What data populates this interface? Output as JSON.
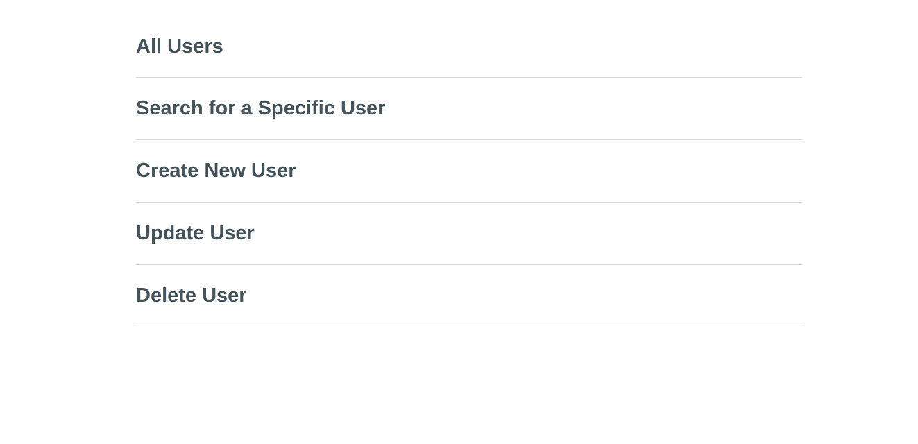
{
  "menu": {
    "items": [
      {
        "label": "All Users"
      },
      {
        "label": "Search for a Specific User"
      },
      {
        "label": "Create New User"
      },
      {
        "label": "Update User"
      },
      {
        "label": "Delete User"
      }
    ]
  },
  "colors": {
    "text": "#44525a",
    "divider": "#d6d6d6",
    "background": "#ffffff"
  }
}
